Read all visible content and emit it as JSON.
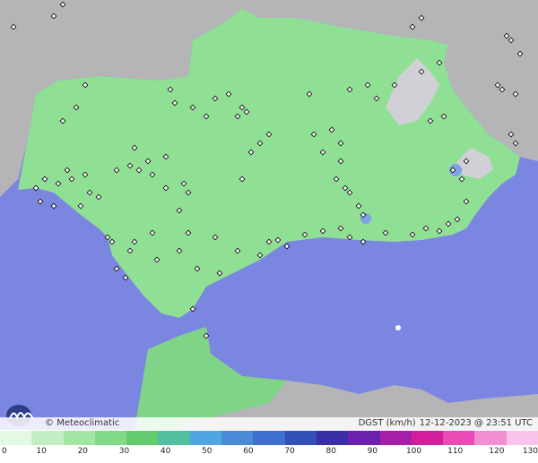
{
  "map": {
    "brand": "Meteoclimatic",
    "variable": "DGST (km/h)",
    "timestamp": "12-12-2023 @ 23:51 UTC",
    "colors": {
      "sea": "#7b86e0",
      "land_outside": "#b5b5b8",
      "land_region": "#8fe095",
      "relief": "#d0d0d6",
      "stations": "#ffffff",
      "gust_spot": "#7fa3e6"
    }
  },
  "legend": {
    "labels": [
      "0",
      "10",
      "20",
      "30",
      "40",
      "50",
      "60",
      "70",
      "80",
      "90",
      "100",
      "110",
      "120",
      "130"
    ],
    "colors": [
      "#e2f9e2",
      "#c2f0c4",
      "#a3e6a4",
      "#83da86",
      "#64cc6e",
      "#50c0a0",
      "#4fa6e0",
      "#4a8bd8",
      "#3f6fcf",
      "#3350b8",
      "#3b2fa8",
      "#6d1fae",
      "#a51fa8",
      "#d21e9c",
      "#e84ab6",
      "#f28fd2",
      "#f9c4ea"
    ]
  }
}
